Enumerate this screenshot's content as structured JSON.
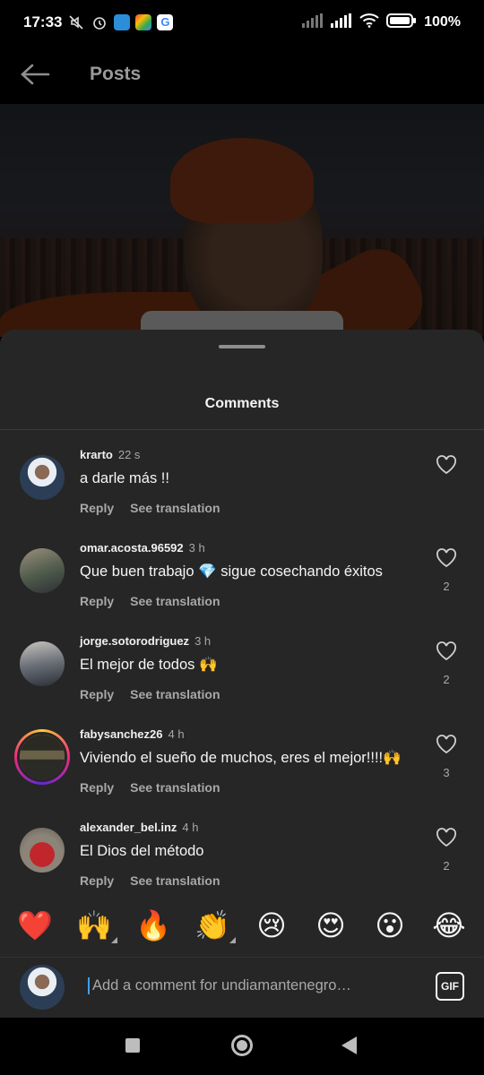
{
  "status_bar": {
    "time": "17:33",
    "battery": "100%",
    "icons": [
      "mute-icon",
      "alarm-icon",
      "app-icon-a",
      "app-icon-b",
      "google-icon",
      "signal-icon",
      "signal-icon",
      "wifi-icon",
      "battery-icon"
    ]
  },
  "header": {
    "title": "Posts",
    "back_icon": "arrow-left-icon"
  },
  "sheet": {
    "title": "Comments",
    "comments": [
      {
        "user": "krarto",
        "time": "22 s",
        "text": "a darle más !!",
        "reply": "Reply",
        "translate": "See translation",
        "likes": "",
        "avatar_color": "#b9c3cf",
        "ring": false
      },
      {
        "user": "omar.acosta.96592",
        "time": "3 h",
        "text": "Que buen trabajo 💎 sigue cosechando éxitos",
        "reply": "Reply",
        "translate": "See translation",
        "likes": "2",
        "avatar_color": "#6d6a5e",
        "ring": false
      },
      {
        "user": "jorge.sotorodriguez",
        "time": "3 h",
        "text": "El mejor de todos 🙌",
        "reply": "Reply",
        "translate": "See translation",
        "likes": "2",
        "avatar_color": "#4f5560",
        "ring": false
      },
      {
        "user": "fabysanchez26",
        "time": "4 h",
        "text": "Viviendo el sueño de muchos, eres el mejor!!!!🙌",
        "reply": "Reply",
        "translate": "See translation",
        "likes": "3",
        "avatar_color": "#3a3a2e",
        "ring": true
      },
      {
        "user": "alexander_bel.inz",
        "time": "4 h",
        "text": "El Dios del método",
        "reply": "Reply",
        "translate": "See translation",
        "likes": "2",
        "avatar_color": "#9b2a2a",
        "ring": false
      }
    ]
  },
  "emoji_bar": [
    {
      "glyph": "❤️",
      "more": false
    },
    {
      "glyph": "🙌",
      "more": true
    },
    {
      "glyph": "🔥",
      "more": false
    },
    {
      "glyph": "👏",
      "more": true
    },
    {
      "glyph": "😢",
      "more": false
    },
    {
      "glyph": "😍",
      "more": false
    },
    {
      "glyph": "😮",
      "more": false
    },
    {
      "glyph": "😂",
      "more": false
    }
  ],
  "composer": {
    "placeholder": "Add a comment for undiamantenegro…",
    "gif_label": "GIF"
  },
  "colors": {
    "background": "#000000",
    "sheet": "#262626",
    "muted_text": "#a8a8a8",
    "accent_cursor": "#3aa0ff"
  }
}
